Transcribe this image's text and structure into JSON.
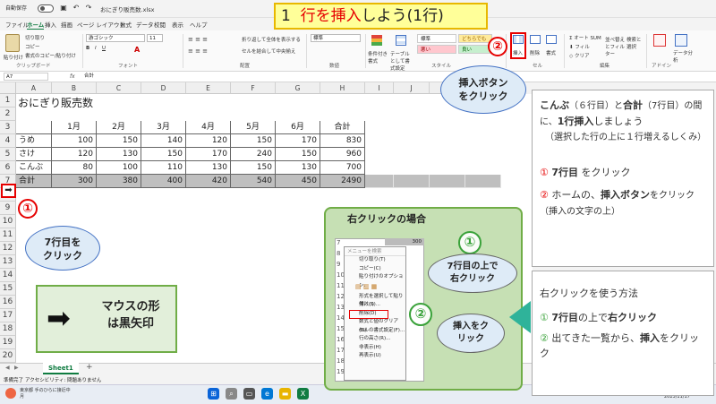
{
  "titlebar": {
    "autosave": "自動保存",
    "toggle_state": "オフ",
    "filename": "おにぎり販売数.xlsx"
  },
  "menu": {
    "items": [
      "ファイル",
      "ホーム",
      "挿入",
      "描画",
      "ページ レイアウト",
      "数式",
      "データ",
      "校閲",
      "表示",
      "ヘルプ"
    ],
    "active": "ホーム"
  },
  "ribbon": {
    "clipboard": {
      "label": "クリップボード",
      "paste": "貼り付け",
      "cut": "切り取り",
      "copy": "コピー",
      "format_painter": "書式のコピー/貼り付け"
    },
    "font": {
      "label": "フォント",
      "name": "游ゴシック",
      "size": "11"
    },
    "alignment": {
      "label": "配置",
      "wrap": "折り返して全体を表示する",
      "merge": "セルを結合して中央揃え"
    },
    "number": {
      "label": "数値",
      "format": "標準"
    },
    "styles": {
      "label": "スタイル",
      "conditional": "条件付き書式",
      "table": "テーブルとして書式設定",
      "normal": "標準",
      "neutral": "どちらでも",
      "bad": "悪い",
      "good": "良い"
    },
    "cells": {
      "label": "セル",
      "insert": "挿入",
      "delete": "削除",
      "format": "書式"
    },
    "editing": {
      "label": "編集",
      "autosum": "オート SUM",
      "fill": "フィル",
      "clear": "クリア",
      "sort": "並べ替えとフィルター",
      "find": "検索と選択"
    },
    "addins": {
      "label": "アドイン",
      "data_analysis": "データ分析"
    }
  },
  "formula": {
    "namebox": "A7",
    "fx": "fx",
    "value": "合計"
  },
  "columns": [
    "A",
    "B",
    "C",
    "D",
    "E",
    "F",
    "G",
    "H",
    "I",
    "J",
    "K",
    "L"
  ],
  "rows": [
    "1",
    "2",
    "3",
    "4",
    "5",
    "6",
    "7",
    "8",
    "9",
    "10",
    "11",
    "12",
    "13",
    "14",
    "15",
    "16",
    "17",
    "18",
    "19",
    "20"
  ],
  "sheet": {
    "title": "おにぎり販売数",
    "header": [
      "",
      "1月",
      "2月",
      "3月",
      "4月",
      "5月",
      "6月",
      "合計"
    ],
    "data": [
      [
        "うめ",
        "100",
        "150",
        "140",
        "120",
        "150",
        "170",
        "830"
      ],
      [
        "さけ",
        "120",
        "130",
        "150",
        "170",
        "240",
        "150",
        "960"
      ],
      [
        "こんぶ",
        "80",
        "100",
        "110",
        "130",
        "150",
        "130",
        "700"
      ],
      [
        "合計",
        "300",
        "380",
        "400",
        "420",
        "540",
        "450",
        "2490"
      ]
    ]
  },
  "tab": {
    "name": "Sheet1",
    "add": "+"
  },
  "status": {
    "ready": "準備完了",
    "accessibility": "アクセシビリティ: 問題ありません"
  },
  "taskbar": {
    "weather1": "東京都 手のひらに接近中",
    "weather2": "月",
    "date": "2023/11/17"
  },
  "overlay": {
    "title_prefix": "1",
    "title_red": "行を挿入",
    "title_suffix": "しよう(1行)",
    "step1_marker": "①",
    "step2_marker": "②",
    "insert_callout_1": "挿入ボタン",
    "insert_callout_2": "をクリック",
    "row7_callout_1": "7行目を",
    "row7_callout_2": "クリック",
    "mouse_title_1": "マウスの形",
    "mouse_title_2": "は黒矢印",
    "right_click_title": "右クリックの場合",
    "rc_callout1_1": "7行目の上で",
    "rc_callout1_2": "右クリック",
    "rc_callout2_1": "挿入をク",
    "rc_callout2_2": "リック",
    "info1": {
      "p1_a": "こんぶ",
      "p1_b": "（６行目）と",
      "p1_c": "合計",
      "p1_d": "（7行目）の間に、",
      "p1_e": "1行挿入",
      "p1_f": "しましょう",
      "p2": "（選択した行の上に１行増えるしくみ）",
      "s1_num": "①",
      "s1_bold": "7行目",
      "s1_rest": " をクリック",
      "s2_num": "②",
      "s2_a": " ホームの、",
      "s2_bold": "挿入ボタン",
      "s2_b": "をクリック（挿入の文字の上）"
    },
    "info2": {
      "heading": "右クリックを使う方法",
      "s1_num": "①",
      "s1_bold1": "7行目",
      "s1_mid": "の上で",
      "s1_bold2": "右クリック",
      "s2_num": "②",
      "s2_a": " 出てきた一覧から、",
      "s2_bold": "挿入",
      "s2_b": "をクリック"
    }
  },
  "context_menu": {
    "search": "メニューを検索",
    "items": [
      "切り取り(T)",
      "コピー(C)",
      "貼り付けのオプション:",
      "",
      "形式を選択して貼り付け(S)...",
      "挿入(I)",
      "削除(D)",
      "数式と値のクリア(N)",
      "セルの書式設定(F)...",
      "行の高さ(R)...",
      "非表示(H)",
      "再表示(U)"
    ],
    "highlight": "挿入(I)",
    "rows": [
      "7",
      "8",
      "9",
      "10",
      "11",
      "12",
      "13",
      "14",
      "15",
      "16",
      "17",
      "18",
      "19"
    ],
    "cell_value": "300"
  }
}
